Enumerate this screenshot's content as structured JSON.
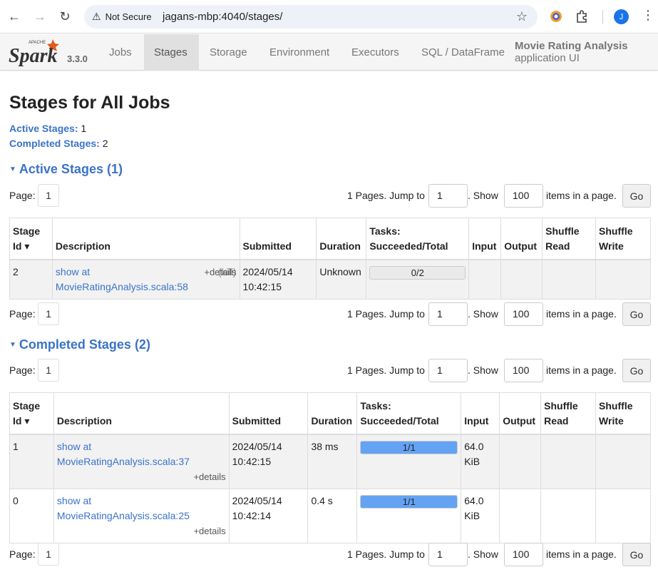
{
  "browser": {
    "security_label": "Not Secure",
    "url": "jagans-mbp:4040/stages/",
    "profile_initial": "J"
  },
  "navbar": {
    "logo_text": "Spark",
    "version": "3.3.0",
    "tabs": [
      "Jobs",
      "Stages",
      "Storage",
      "Environment",
      "Executors",
      "SQL / DataFrame"
    ],
    "active_tab": "Stages",
    "app_name": "Movie Rating Analysis",
    "app_suffix": "application UI"
  },
  "page": {
    "title": "Stages for All Jobs",
    "active_label": "Active Stages:",
    "active_count": "1",
    "completed_label": "Completed Stages:",
    "completed_count": "2"
  },
  "pager": {
    "page_label": "Page:",
    "page_value": "1",
    "jump_text": "1 Pages. Jump to",
    "jump_value": "1",
    "show_text": ". Show",
    "show_value": "100",
    "items_text": "items in a page.",
    "go_label": "Go"
  },
  "active_section": {
    "title": "Active Stages (1)",
    "headers": [
      "Stage Id ▾",
      "Description",
      "Submitted",
      "Duration",
      "Tasks: Succeeded/Total",
      "Input",
      "Output",
      "Shuffle Read",
      "Shuffle Write"
    ],
    "rows": [
      {
        "id": "2",
        "desc_line1": "show at",
        "desc_line2": "MovieRatingAnalysis.scala:58",
        "kill": "(kill)",
        "details": "+details",
        "submitted": "2024/05/14 10:42:15",
        "duration": "Unknown",
        "tasks": "0/2",
        "progress": 0.0,
        "input": "",
        "output": "",
        "shuffle_read": "",
        "shuffle_write": ""
      }
    ]
  },
  "completed_section": {
    "title": "Completed Stages (2)",
    "headers": [
      "Stage Id ▾",
      "Description",
      "Submitted",
      "Duration",
      "Tasks: Succeeded/Total",
      "Input",
      "Output",
      "Shuffle Read",
      "Shuffle Write"
    ],
    "rows": [
      {
        "id": "1",
        "desc_line1": "show at",
        "desc_line2": "MovieRatingAnalysis.scala:37",
        "details": "+details",
        "submitted": "2024/05/14 10:42:15",
        "duration": "38 ms",
        "tasks": "1/1",
        "progress": 1.0,
        "input": "64.0 KiB",
        "output": "",
        "shuffle_read": "",
        "shuffle_write": ""
      },
      {
        "id": "0",
        "desc_line1": "show at",
        "desc_line2": "MovieRatingAnalysis.scala:25",
        "details": "+details",
        "submitted": "2024/05/14 10:42:14",
        "duration": "0.4 s",
        "tasks": "1/1",
        "progress": 1.0,
        "input": "64.0 KiB",
        "output": "",
        "shuffle_read": "",
        "shuffle_write": ""
      }
    ]
  },
  "colors": {
    "link": "#3b73c8",
    "progress_fill": "#64a3f3",
    "logo_orange": "#e25a1c"
  }
}
